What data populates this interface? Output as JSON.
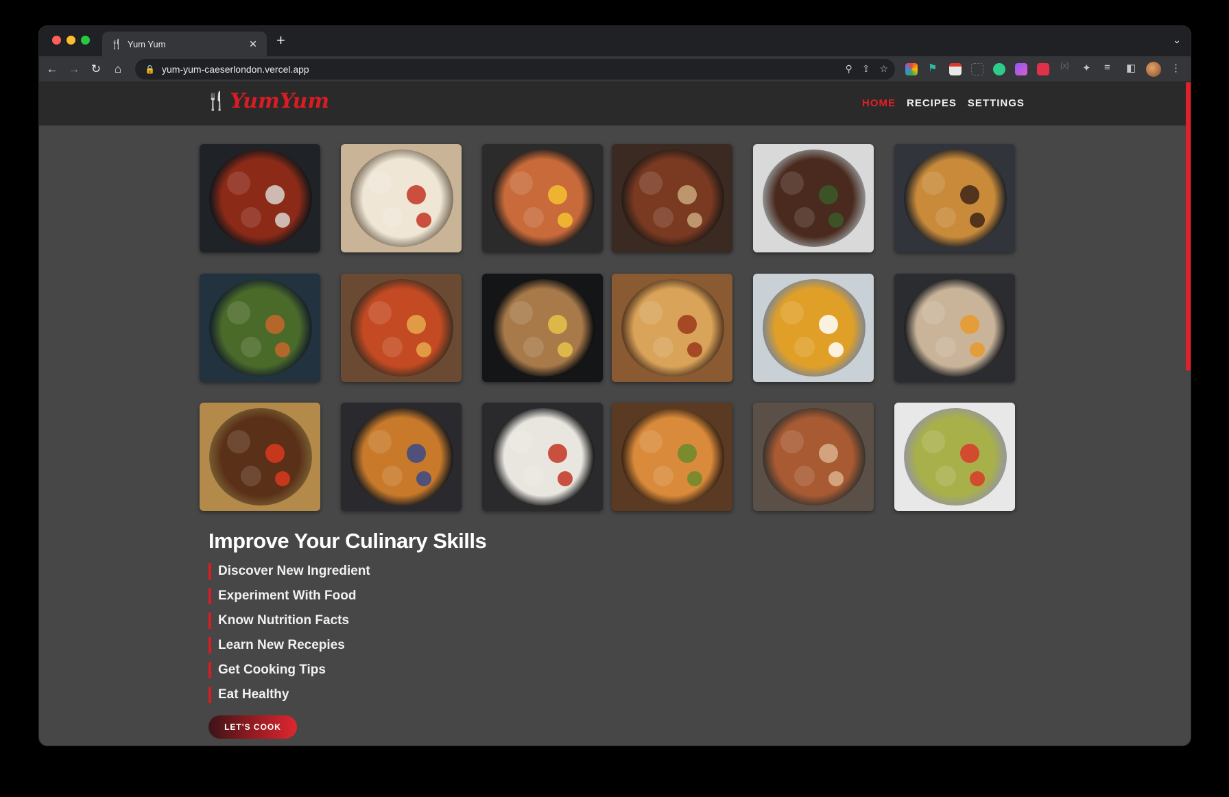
{
  "browser": {
    "tab_title": "Yum Yum",
    "url": "yum-yum-caeserlondon.vercel.app"
  },
  "site": {
    "logo_text": "YumYum",
    "nav": [
      {
        "label": "HOME",
        "active": true
      },
      {
        "label": "RECIPES",
        "active": false
      },
      {
        "label": "SETTINGS",
        "active": false
      }
    ]
  },
  "gallery": [
    {
      "name": "tandoori-chicken",
      "bg": "#1f2226",
      "food": "#8c2a18",
      "accent": "#d9d3cf"
    },
    {
      "name": "margherita-pizza",
      "bg": "#c9b497",
      "food": "#efe6d6",
      "accent": "#c33422"
    },
    {
      "name": "bibimbap",
      "bg": "#2b2b2b",
      "food": "#c86a3a",
      "accent": "#f5c030"
    },
    {
      "name": "korean-table",
      "bg": "#3a2a22",
      "food": "#7a3a22",
      "accent": "#c9a77b"
    },
    {
      "name": "steak-broccolini",
      "bg": "#d9d9d9",
      "food": "#4a2a1e",
      "accent": "#3a5a2a"
    },
    {
      "name": "cheeseburger",
      "bg": "#31343a",
      "food": "#c98a3a",
      "accent": "#3d2419"
    },
    {
      "name": "green-salad",
      "bg": "#22323f",
      "food": "#4a6a2a",
      "accent": "#c6662a"
    },
    {
      "name": "pepperoni-pizza",
      "bg": "#6a4a32",
      "food": "#c34a22",
      "accent": "#e8a84a"
    },
    {
      "name": "ramen-bowl",
      "bg": "#141517",
      "food": "#a87a4a",
      "accent": "#e8c24a"
    },
    {
      "name": "biryani",
      "bg": "#8a5a32",
      "food": "#d9a45a",
      "accent": "#9a3a1a"
    },
    {
      "name": "pumpkin-soup",
      "bg": "#c9d0d6",
      "food": "#e0a028",
      "accent": "#ffffff"
    },
    {
      "name": "soba-egg",
      "bg": "#2a2c30",
      "food": "#c9b49a",
      "accent": "#e89a2a"
    },
    {
      "name": "kebab-fries",
      "bg": "#b48a4a",
      "food": "#5a3018",
      "accent": "#d9381e"
    },
    {
      "name": "french-toast",
      "bg": "#2a2a2e",
      "food": "#c87a2a",
      "accent": "#3a4a8a"
    },
    {
      "name": "rice-bowl",
      "bg": "#2a2a2c",
      "food": "#e9e6df",
      "accent": "#c33422"
    },
    {
      "name": "tacos",
      "bg": "#5a3a22",
      "food": "#d98a3a",
      "accent": "#6a8a2a"
    },
    {
      "name": "grilled-platter",
      "bg": "#5a5048",
      "food": "#a85a32",
      "accent": "#d9b08a"
    },
    {
      "name": "pasta-salad",
      "bg": "#e8e8e8",
      "food": "#a8b04a",
      "accent": "#d93a2a"
    }
  ],
  "content": {
    "headline": "Improve Your Culinary Skills",
    "skills": [
      "Discover New Ingredient",
      "Experiment With Food",
      "Know Nutrition Facts",
      "Learn New Recepies",
      "Get Cooking Tips",
      "Eat Healthy"
    ],
    "cta_label": "LET'S COOK"
  },
  "colors": {
    "brand": "#d81c23",
    "page_bg": "#474747",
    "header_bg": "#2a2a2a"
  }
}
